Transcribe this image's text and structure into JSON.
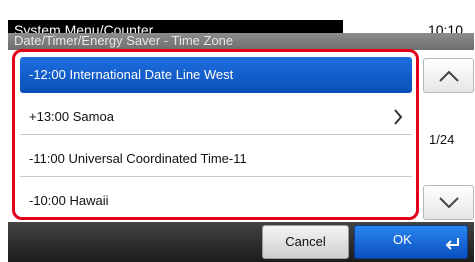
{
  "header": {
    "title": "System Menu/Counter.",
    "time": "10:10",
    "subtitle": "Date/Timer/Energy Saver - Time Zone"
  },
  "list": {
    "items": [
      {
        "label": "-12:00 International Date Line West",
        "selected": true
      },
      {
        "label": "+13:00 Samoa",
        "selected": false,
        "has_submenu": true
      },
      {
        "label": "-11:00 Universal Coordinated Time-11",
        "selected": false
      },
      {
        "label": "-10:00 Hawaii",
        "selected": false
      }
    ]
  },
  "pager": {
    "page_indicator": "1/24",
    "up_icon": "chevron-up-icon",
    "down_icon": "chevron-down-icon"
  },
  "footer": {
    "cancel_label": "Cancel",
    "ok_label": "OK",
    "ok_icon": "enter-icon"
  },
  "colors": {
    "selection": "#0a4fb8",
    "highlight_border": "#e3001b",
    "ok_button": "#1a6be0"
  }
}
